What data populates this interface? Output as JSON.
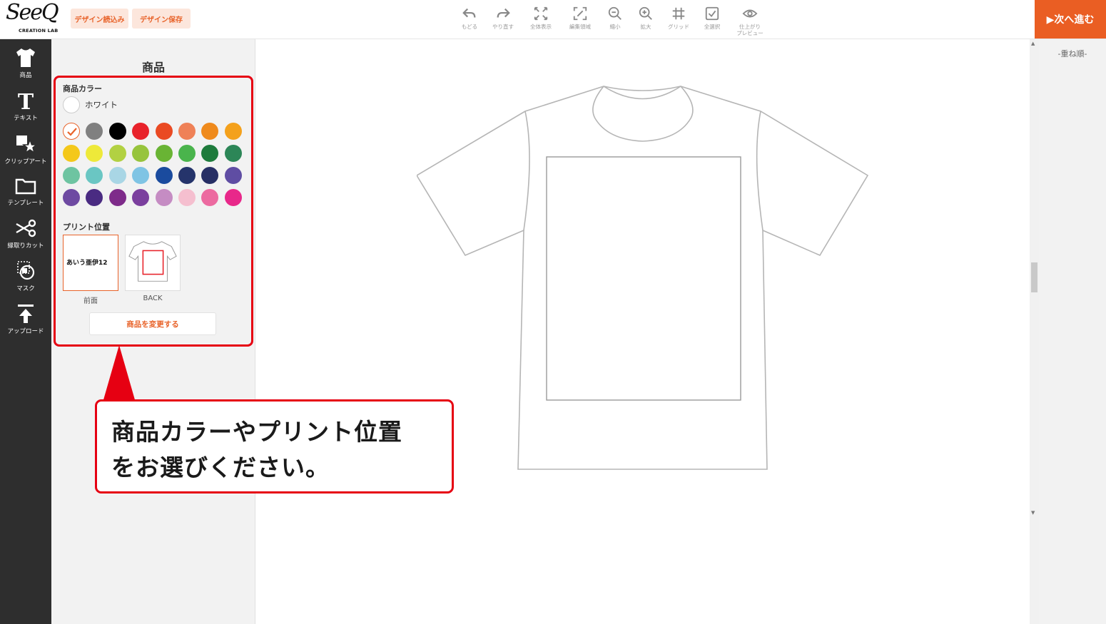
{
  "header": {
    "logo_word": "SeeQ",
    "logo_sub": "CREATION LAB",
    "load_design_label": "デザイン読込み",
    "save_design_label": "デザイン保存",
    "tools": [
      {
        "label": "もどる",
        "icon": "undo-icon"
      },
      {
        "label": "やり直す",
        "icon": "redo-icon"
      },
      {
        "label": "全体表示",
        "icon": "fit-all-icon"
      },
      {
        "label": "編集領域",
        "icon": "edit-area-icon"
      },
      {
        "label": "縮小",
        "icon": "zoom-out-icon"
      },
      {
        "label": "拡大",
        "icon": "zoom-in-icon"
      },
      {
        "label": "グリッド",
        "icon": "grid-icon"
      },
      {
        "label": "全選択",
        "icon": "select-all-icon"
      },
      {
        "label": "仕上がり\nプレビュー",
        "icon": "preview-eye-icon"
      }
    ],
    "next_label": "▶次へ進む"
  },
  "sidebar": {
    "items": [
      {
        "label": "商品",
        "icon": "tshirt-icon"
      },
      {
        "label": "テキスト",
        "icon": "text-icon"
      },
      {
        "label": "クリップアート",
        "icon": "clipart-icon"
      },
      {
        "label": "テンプレート",
        "icon": "folder-icon"
      },
      {
        "label": "縁取りカット",
        "icon": "scissors-icon"
      },
      {
        "label": "マスク",
        "icon": "mask-icon"
      },
      {
        "label": "アップロード",
        "icon": "upload-icon"
      }
    ]
  },
  "panel": {
    "title": "商品",
    "color_section_label": "商品カラー",
    "selected_color_name": "ホワイト",
    "colors": [
      "#ffffff",
      "#808080",
      "#000000",
      "#e8222a",
      "#ea4a23",
      "#ef8157",
      "#ef8a1c",
      "#f4a11c",
      "#f4c81a",
      "#eee939",
      "#b2d142",
      "#97c43c",
      "#69b434",
      "#4ab44c",
      "#1e7b3c",
      "#2c8657",
      "#6ec4a1",
      "#6ac6c3",
      "#a9d6e5",
      "#7fc4e4",
      "#1a4b9e",
      "#25346b",
      "#272f65",
      "#5f4da3",
      "#6e4aa2",
      "#4a2b82",
      "#7e2b8a",
      "#7b3f9e",
      "#c58cc3",
      "#f5bfcf",
      "#ec6aa0",
      "#e8288a"
    ],
    "print_section_label": "プリント位置",
    "positions": [
      {
        "label": "前面",
        "preview_text": "あいう亜伊12"
      },
      {
        "label": "BACK"
      }
    ],
    "change_product_label": "商品を変更する"
  },
  "annotation": {
    "line1": "商品カラーやプリント位置",
    "line2": "をお選びください。"
  },
  "layer_panel": {
    "title": "-重ね順-"
  }
}
